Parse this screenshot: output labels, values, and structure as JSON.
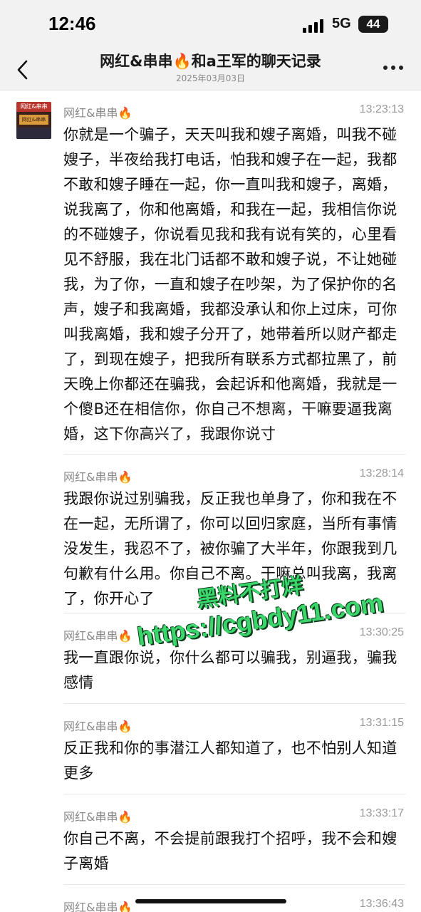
{
  "status_bar": {
    "time": "12:46",
    "network": "5G",
    "battery": "44"
  },
  "header": {
    "title": "网红&串串🔥和a王军的聊天记录",
    "date": "2025年03月03日"
  },
  "avatar": {
    "top_text": "网红&串串",
    "mid_text": "网红&串串"
  },
  "messages": [
    {
      "sender": "网红&串串🔥",
      "time": "13:23:13",
      "text": "你就是一个骗子，天天叫我和嫂子离婚，叫我不碰嫂子，半夜给我打电话，怕我和嫂子在一起，我都不敢和嫂子睡在一起，你一直叫我和嫂子，离婚，说我离了，你和他离婚，和我在一起，我相信你说的不碰嫂子，你说看见我和我有说有笑的，心里看见不舒服，我在北门话都不敢和嫂子说，不让她碰我，为了你，一直和嫂子在吵架，为了保护你的名声，嫂子和我离婚，我都没承认和你上过床，可你叫我离婚，我和嫂子分开了，她带着所以财产都走了，到现在嫂子，把我所有联系方式都拉黑了，前天晚上你都还在骗我，会起诉和他离婚，我就是一个傻B还在相信你，你自己不想离，干嘛要逼我离婚，这下你高兴了，我跟你说寸"
    },
    {
      "sender": "网红&串串🔥",
      "time": "13:28:14",
      "text": "我跟你说过别骗我，反正我也单身了，你和我在不在一起，无所谓了，你可以回归家庭，当所有事情没发生，我忍不了，被你骗了大半年，你跟我到几句歉有什么用。你自己不离。干嘛总叫我离，我离了，你开心了"
    },
    {
      "sender": "网红&串串🔥",
      "time": "13:30:25",
      "text": "我一直跟你说，你什么都可以骗我，别逼我，骗我感情"
    },
    {
      "sender": "网红&串串🔥",
      "time": "13:31:15",
      "text": "反正我和你的事潜江人都知道了，也不怕别人知道更多"
    },
    {
      "sender": "网红&串串🔥",
      "time": "13:33:17",
      "text": "你自己不离，不会提前跟我打个招呼，我不会和嫂子离婚"
    },
    {
      "sender": "网红&串串🔥",
      "time": "13:36:43",
      "text": ""
    }
  ],
  "watermark": {
    "line1": "黑料不打烊",
    "line2": "https://cgbdy11.com"
  },
  "colors": {
    "bar_bg": "#f2f2f2",
    "sender": "#8a8a8a",
    "watermark": "#3bd66b"
  }
}
